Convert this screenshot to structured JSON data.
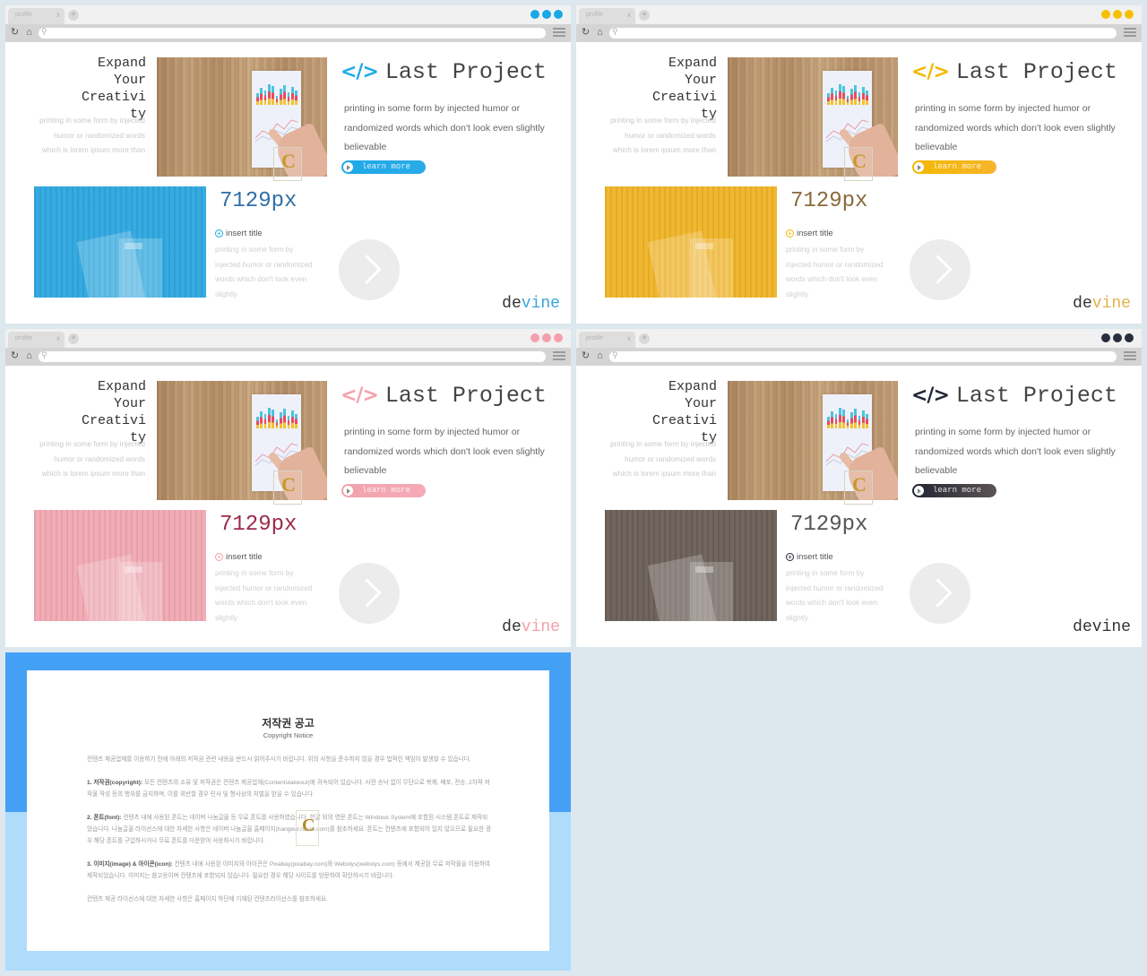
{
  "browser": {
    "tab_label": "profile",
    "tab_close": "x",
    "new_tab": "+",
    "reload_icon": "reload-icon",
    "home_icon": "home-icon",
    "search_icon": "search-icon",
    "menu_icon": "hamburger-menu-icon"
  },
  "slide": {
    "expand_title": "Expand\nYour\nCreativi\nty",
    "expand_body": "printing in some form by injected humor or randomized words which is lorem ipsum more than",
    "last_project_title": "Last Project",
    "code_icon": "</>",
    "last_project_body": "printing in some form by injected humor or randomized words which don't look even slightly believable",
    "learn_more": "learn more",
    "px_value": "7129px",
    "insert_title": "insert title",
    "insert_body": "printing in some form by injected humor or randomized words which don't look even slightly",
    "brand_prefix": "de",
    "brand_suffix": "vine",
    "watermark": "C"
  },
  "variants": [
    {
      "name": "blue",
      "dot_color": "#1aa7e6",
      "accent": "#1fa9e8",
      "button_color": "#2aaae8",
      "px_color": "#2f6fa6",
      "photo_color": "#2fa8e0",
      "brand_accent": "#3aa6dc"
    },
    {
      "name": "yellow",
      "dot_color": "#f5c000",
      "accent": "#f3b800",
      "button_color": "#f6b52c",
      "px_color": "#8a6a3c",
      "photo_color": "#f0b428",
      "brand_accent": "#e2b24a"
    },
    {
      "name": "pink",
      "dot_color": "#f4a0aa",
      "accent": "#f2a2ac",
      "button_color": "#f5aab8",
      "px_color": "#9c2b4a",
      "photo_color": "#f1a9b3",
      "brand_accent": "#f2a0ad"
    },
    {
      "name": "dark",
      "dot_color": "#2a2d3e",
      "accent": "#222533",
      "button_color": "#5c5454",
      "px_color": "#555555",
      "photo_color": "#6b6058",
      "brand_accent": "#333333"
    }
  ],
  "copyright": {
    "title": "저작권 공고",
    "subtitle": "Copyright Notice",
    "paragraphs": [
      {
        "lead": "",
        "text": "컨텐츠 제공업체를 이용하기 전에 아래의 저작권 관련 내용을 반드시 읽어주시기 바랍니다. 위의 사항을 준수하지 않을 경우 법적인 책임이 발생할 수 있습니다."
      },
      {
        "lead": "1. 저작권(copyright):",
        "text": "모든 컨텐츠의 소유 및 저작권은 컨텐츠 제공업체(Contentstakeout)에 귀속되어 있습니다. 사전 승낙 없이 무단으로 복제, 배포, 전송, 2차적 저작물 작성 등의 행위를 금지하며, 이를 위반할 경우 민사 및 형사상의 처벌을 받을 수 있습니다."
      },
      {
        "lead": "2. 폰트(font):",
        "text": "컨텐츠 내에 사용된 폰트는 네이버 나눔글꼴 등 무료 폰트를 사용하였습니다. 한글 외의 영문 폰트는 Windows System에 포함된 시스템 폰트로 제작되었습니다. 나눔글꼴 라이선스에 대한 자세한 사항은 네이버 나눔글꼴 홈페이지(hangeul.naver.com)를 참조하세요. 폰트는 컨텐츠에 포함되어 있지 않으므로 필요한 경우 해당 폰트를 구입하시거나 무료 폰트를 다운받아 사용하시기 바랍니다."
      },
      {
        "lead": "3. 이미지(image) & 아이콘(icon):",
        "text": "컨텐츠 내에 사용된 이미지와 아이콘은 Pixabay(pixabay.com)와 Webolys(webolys.com) 등에서 제공된 무료 저작물을 이용하여 제작되었습니다. 이미지는 참고용이며 컨텐츠에 포함되지 않습니다. 필요한 경우 해당 사이트를 방문하여 확인하시기 바랍니다."
      },
      {
        "lead": "",
        "text": "컨텐츠 제공 라이선스에 대한 자세한 사항은 홈페이지 하단에 기재된 컨텐츠라이선스를 참조하세요."
      }
    ]
  }
}
